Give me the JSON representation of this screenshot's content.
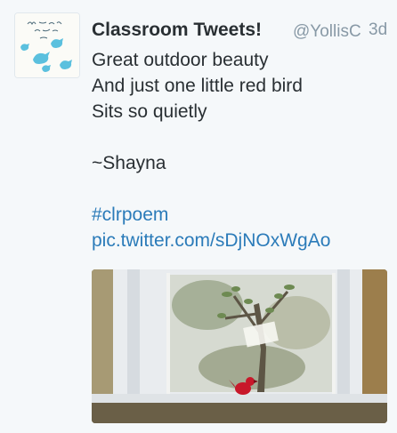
{
  "tweet": {
    "avatar_caption": "Mrs. Yollis' 3rd Grade Class",
    "display_name": "Classroom Tweets!",
    "handle": "@YollisC",
    "timestamp": "3d",
    "lines": [
      "Great outdoor beauty",
      "And just one little red bird",
      "Sits so quietly",
      "",
      "~Shayna"
    ],
    "hashtag": "#clrpoem",
    "media_link": "pic.twitter.com/sDjNOxWgAo",
    "media_description": "photo of a window with a small red bird figurine on the sill"
  },
  "colors": {
    "background": "#f5f8fa",
    "text": "#292f33",
    "secondary": "#8899a6",
    "link": "#2b7bb9",
    "bird_red": "#c8182a"
  }
}
